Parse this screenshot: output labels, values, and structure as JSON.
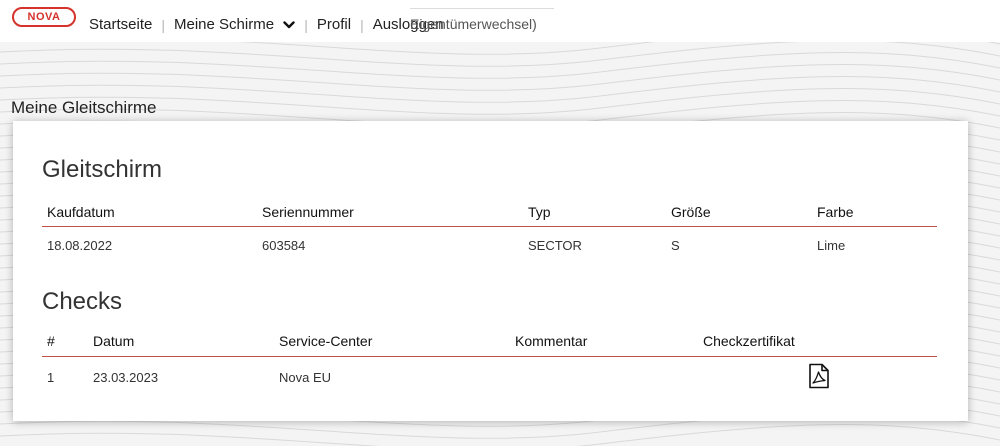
{
  "brand": {
    "logo_text": "NOVA",
    "accent_color": "#d4322a"
  },
  "nav": {
    "home": "Startseite",
    "my_gliders": "Meine Schirme",
    "profile": "Profil",
    "logout": "Ausloggen",
    "ghost_text": "Eigentümerwechsel)"
  },
  "page": {
    "title": "Meine Gleitschirme"
  },
  "glider": {
    "title": "Gleitschirm",
    "columns": [
      "Kaufdatum",
      "Seriennummer",
      "Typ",
      "Größe",
      "Farbe"
    ],
    "rows": [
      [
        "18.08.2022",
        "603584",
        "SECTOR",
        "S",
        "Lime"
      ]
    ]
  },
  "checks": {
    "title": "Checks",
    "columns": [
      "#",
      "Datum",
      "Service-Center",
      "Kommentar",
      "Checkzertifikat"
    ],
    "rows": [
      {
        "num": "1",
        "date": "23.03.2023",
        "center": "Nova EU",
        "comment": "",
        "certificate_icon": "pdf-icon"
      }
    ]
  }
}
